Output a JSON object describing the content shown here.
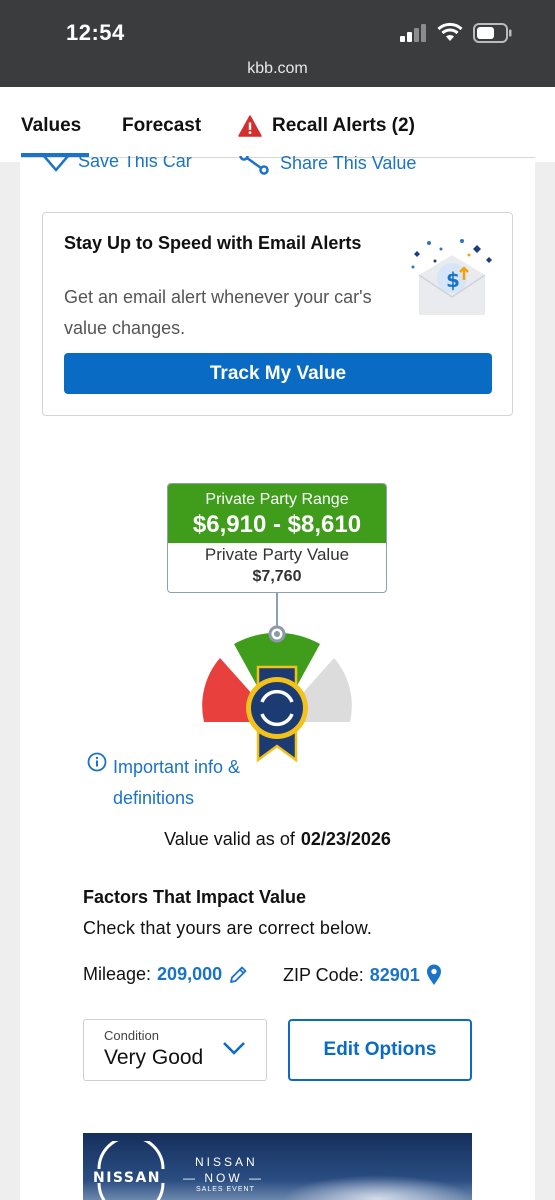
{
  "status": {
    "time": "12:54",
    "url": "kbb.com"
  },
  "tabs": [
    {
      "label": "Values"
    },
    {
      "label": "Forecast"
    },
    {
      "label": "Recall Alerts (2)"
    }
  ],
  "actions": {
    "save": "Save This Car",
    "share": "Share This Value"
  },
  "email_card": {
    "title": "Stay Up to Speed with Email Alerts",
    "body": "Get an email alert whenever your car's value changes.",
    "button": "Track My Value"
  },
  "price": {
    "range_label": "Private Party Range",
    "range_value": "$6,910 - $8,610",
    "value_label": "Private Party Value",
    "value": "$7,760"
  },
  "info_link": "Important info & definitions",
  "valid": {
    "label": "Value valid as of",
    "date": "02/23/2026"
  },
  "factors": {
    "title": "Factors That Impact Value",
    "subtitle": "Check that yours are correct below.",
    "mileage_label": "Mileage:",
    "mileage_value": "209,000",
    "zip_label": "ZIP Code:",
    "zip_value": "82901"
  },
  "condition": {
    "label": "Condition",
    "value": "Very Good"
  },
  "edit_options": "Edit Options",
  "ad": {
    "brand": "NISSAN",
    "line1": "NISSAN",
    "line2": "NOW",
    "line3": "SALES EVENT"
  },
  "colors": {
    "accent": "#0a6bc4",
    "green": "#3f9d1b",
    "red": "#e8403c",
    "status_bg": "#3a3c3e"
  }
}
